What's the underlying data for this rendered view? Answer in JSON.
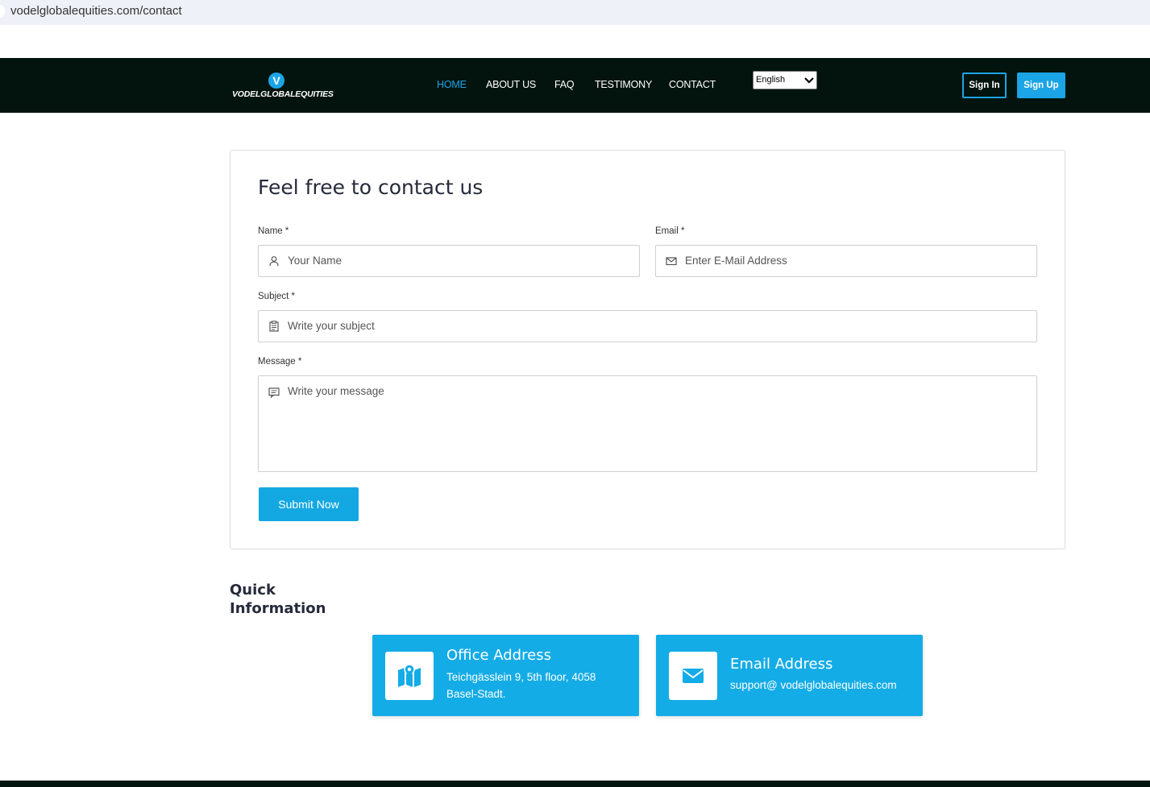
{
  "browser": {
    "url": "vodelglobalequities.com/contact"
  },
  "brand": {
    "name": "VODELGLOBALEQUITIES",
    "mark": "V"
  },
  "nav": {
    "items": [
      {
        "label": "HOME",
        "active": true
      },
      {
        "label": "ABOUT US"
      },
      {
        "label": "FAQ"
      },
      {
        "label": "TESTIMONY"
      },
      {
        "label": "CONTACT"
      }
    ],
    "language": "English",
    "signin": "Sign In",
    "signup": "Sign Up"
  },
  "form": {
    "title": "Feel free to contact us",
    "name_label": "Name *",
    "name_placeholder": "Your Name",
    "email_label": "Email *",
    "email_placeholder": "Enter E-Mail Address",
    "subject_label": "Subject *",
    "subject_placeholder": "Write your subject",
    "message_label": "Message *",
    "message_placeholder": "Write your message",
    "submit": "Submit Now"
  },
  "quick": {
    "title": "Quick Information",
    "office": {
      "title": "Office Address",
      "text": "Teichgässlein 9, 5th floor, 4058 Basel-Stadt."
    },
    "email": {
      "title": "Email Address",
      "text": "support@ vodelglobalequities.com"
    }
  },
  "colors": {
    "accent": "#14ace6",
    "nav_bg": "#03140f",
    "title": "#262a3a"
  }
}
